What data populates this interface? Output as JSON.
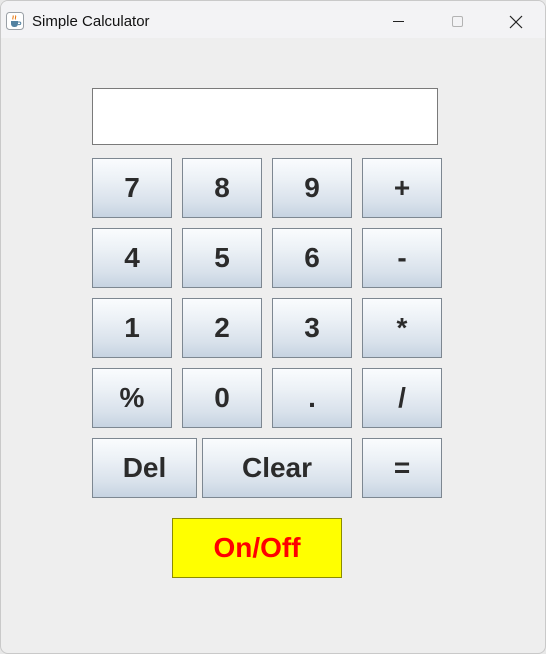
{
  "window": {
    "title": "Simple Calculator",
    "icon": "java-cup-icon",
    "controls": [
      "minimize-icon",
      "maximize-icon",
      "close-icon"
    ]
  },
  "display": {
    "value": ""
  },
  "keypad": {
    "row1": [
      "7",
      "8",
      "9",
      "+"
    ],
    "row2": [
      "4",
      "5",
      "6",
      "-"
    ],
    "row3": [
      "1",
      "2",
      "3",
      "*"
    ],
    "row4": [
      "%",
      "0",
      ".",
      "/"
    ],
    "row5": [
      "Del",
      "Clear",
      "="
    ]
  },
  "power": {
    "label": "On/Off",
    "background": "#ffff00",
    "text_color": "#ff0000"
  }
}
